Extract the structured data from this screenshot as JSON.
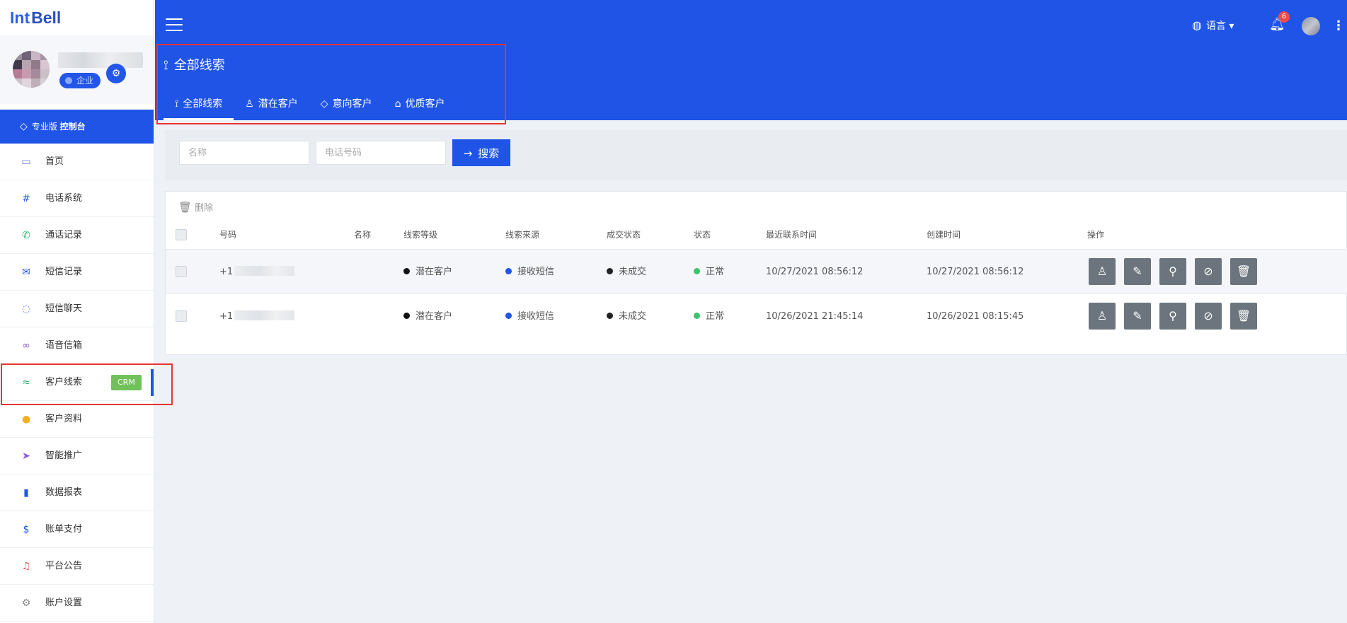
{
  "app": {
    "logo_a": "Int",
    "logo_b": "Bell"
  },
  "profile": {
    "badge": "企业",
    "gear_icon": "settings-gear-icon"
  },
  "pro_bar": {
    "prefix": "专业版",
    "label": "控制台",
    "icon": "diamond-icon"
  },
  "sidebar": {
    "items": [
      {
        "label": "首页",
        "icon": "monitor-icon",
        "color": "#6b7cff"
      },
      {
        "label": "电话系统",
        "icon": "hash-icon",
        "color": "#2f5fe0"
      },
      {
        "label": "通话记录",
        "icon": "phone-icon",
        "color": "#24b36b"
      },
      {
        "label": "短信记录",
        "icon": "envelope-icon",
        "color": "#2356e8"
      },
      {
        "label": "短信聊天",
        "icon": "chat-icon",
        "color": "#6b7cff"
      },
      {
        "label": "语音信箱",
        "icon": "voicemail-icon",
        "color": "#8a5cd6"
      },
      {
        "label": "客户线索",
        "icon": "route-icon",
        "color": "#24b36b",
        "badge": "CRM"
      },
      {
        "label": "客户资料",
        "icon": "user-circle-icon",
        "color": "#f2b01e"
      },
      {
        "label": "智能推广",
        "icon": "paper-plane-icon",
        "color": "#8a5cd6"
      },
      {
        "label": "数据报表",
        "icon": "bar-chart-icon",
        "color": "#2356e8"
      },
      {
        "label": "账单支付",
        "icon": "dollar-icon",
        "color": "#2356e8"
      },
      {
        "label": "平台公告",
        "icon": "bell-icon",
        "color": "#e65a5a"
      },
      {
        "label": "账户设置",
        "icon": "cogs-icon",
        "color": "#888888"
      }
    ]
  },
  "header": {
    "title": "全部线索",
    "tabs": [
      {
        "label": "全部线索",
        "icon": "route-icon"
      },
      {
        "label": "潜在客户",
        "icon": "user-icon"
      },
      {
        "label": "意向客户",
        "icon": "diamond-icon"
      },
      {
        "label": "优质客户",
        "icon": "basket-icon"
      }
    ],
    "language": "语言",
    "notification_count": "6"
  },
  "filters": {
    "name_placeholder": "名称",
    "phone_placeholder": "电话号码",
    "search_label": "搜索"
  },
  "table": {
    "delete_label": "删除",
    "columns": [
      "号码",
      "名称",
      "线索等级",
      "线索来源",
      "成交状态",
      "状态",
      "最近联系时间",
      "创建时间",
      "操作"
    ],
    "rows": [
      {
        "number_prefix": "+1",
        "name": "",
        "level": "潜在客户",
        "source": "接收短信",
        "deal": "未成交",
        "status": "正常",
        "last_contact": "10/27/2021 08:56:12",
        "created": "10/27/2021 08:56:12"
      },
      {
        "number_prefix": "+1",
        "name": "",
        "level": "潜在客户",
        "source": "接收短信",
        "deal": "未成交",
        "status": "正常",
        "last_contact": "10/26/2021 21:45:14",
        "created": "10/26/2021 08:15:45"
      }
    ],
    "status_colors": {
      "level": "#111111",
      "source": "#1f54e6",
      "deal": "#222222",
      "status": "#3cc46a"
    },
    "action_icons": [
      "user-icon",
      "edit-icon",
      "assign-user-icon",
      "ban-icon",
      "trash-icon"
    ]
  },
  "colors": {
    "brand": "#1f54e6",
    "highlight_box": "#e63434",
    "crm_badge": "#71c15b"
  }
}
